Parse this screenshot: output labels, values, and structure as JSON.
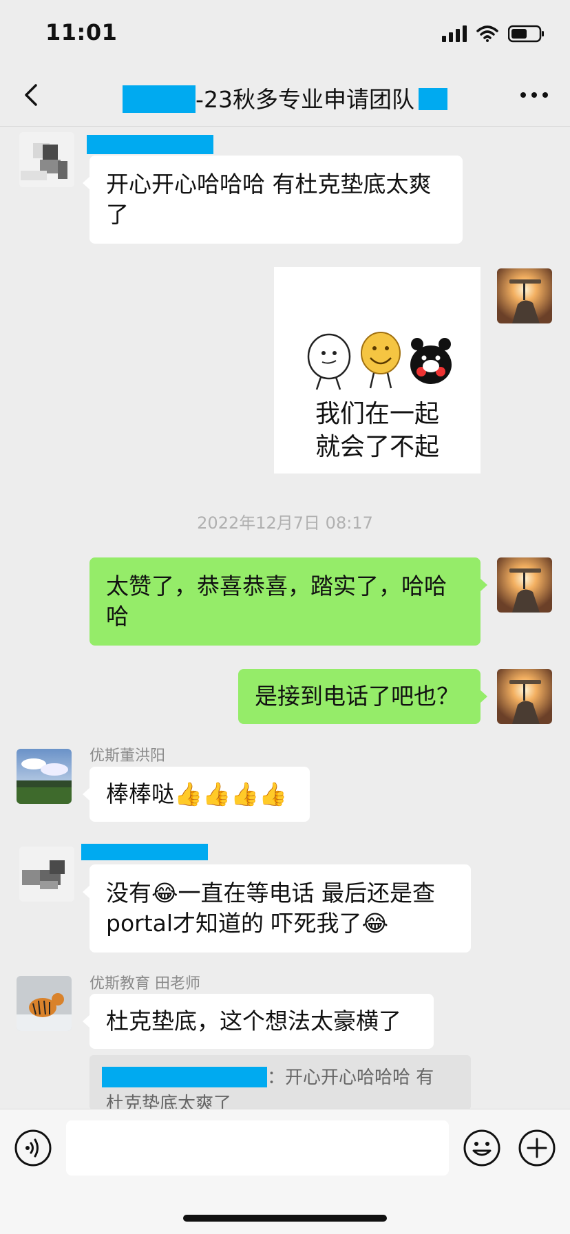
{
  "status_bar": {
    "time": "11:01",
    "signal_icon": "signal-icon",
    "wifi_icon": "wifi-icon",
    "battery_icon": "battery-icon"
  },
  "nav": {
    "title_suffix": "-23秋多专业申请团队",
    "back_icon": "chevron-left-icon",
    "more_icon": "more-horizontal-icon"
  },
  "messages": {
    "m1": {
      "text": "开心开心哈哈哈 有杜克垫底太爽了"
    },
    "m2": {
      "sticker_line1": "我们在一起",
      "sticker_line2": "就会了不起"
    },
    "timestamp": "2022年12月7日 08:17",
    "m3": {
      "text": "太赞了，恭喜恭喜，踏实了，哈哈哈"
    },
    "m4": {
      "text": "是接到电话了吧也？"
    },
    "m5": {
      "sender": "优斯董洪阳",
      "text": "棒棒哒👍👍👍👍"
    },
    "m6": {
      "text": "没有😂一直在等电话 最后还是查portal才知道的 吓死我了😂"
    },
    "m7": {
      "sender": "优斯教育 田老师",
      "text": "杜克垫底，这个想法太豪横了"
    },
    "quote": {
      "separator": "：",
      "line1": "开心开心哈哈哈 有",
      "line2": "杜克垫底太爽了"
    }
  },
  "input": {
    "value": "",
    "placeholder": ""
  },
  "colors": {
    "accent_green": "#95ec69",
    "background": "#ededed",
    "redaction": "#00aaf0"
  }
}
